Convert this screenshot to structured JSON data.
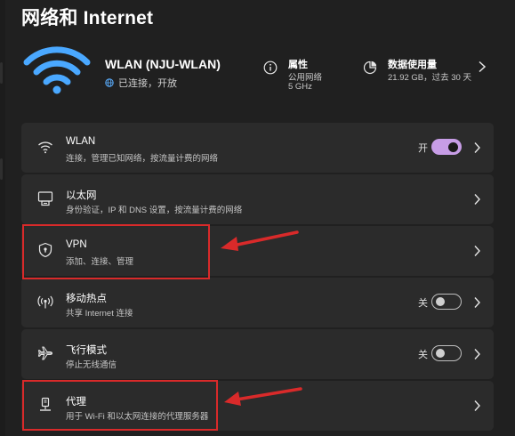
{
  "page": {
    "title": "网络和 Internet"
  },
  "header": {
    "network_name": "WLAN (NJU-WLAN)",
    "network_status": "已连接，开放",
    "properties": {
      "title": "属性",
      "line1": "公用网络",
      "line2": "5 GHz"
    },
    "usage": {
      "title": "数据使用量",
      "line1": "21.92 GB，过去 30 天"
    }
  },
  "rows": [
    {
      "title": "WLAN",
      "desc": "连接，管理已知网络，按流量计费的网络",
      "toggle_label": "开",
      "toggle": "on",
      "icon": "wifi-icon"
    },
    {
      "title": "以太网",
      "desc": "身份验证，IP 和 DNS 设置，按流量计费的网络",
      "icon": "ethernet-icon"
    },
    {
      "title": "VPN",
      "desc": "添加、连接、管理",
      "icon": "shield-icon"
    },
    {
      "title": "移动热点",
      "desc": "共享 Internet 连接",
      "toggle_label": "关",
      "toggle": "off",
      "icon": "hotspot-icon"
    },
    {
      "title": "飞行模式",
      "desc": "停止无线通信",
      "toggle_label": "关",
      "toggle": "off",
      "icon": "airplane-icon"
    },
    {
      "title": "代理",
      "desc": "用于 Wi-Fi 和以太网连接的代理服务器",
      "icon": "proxy-icon"
    }
  ],
  "colors": {
    "accent": "#c79de6",
    "annotation": "#d92a2a",
    "row_bg": "#2b2b2b",
    "page_bg": "#202020"
  }
}
